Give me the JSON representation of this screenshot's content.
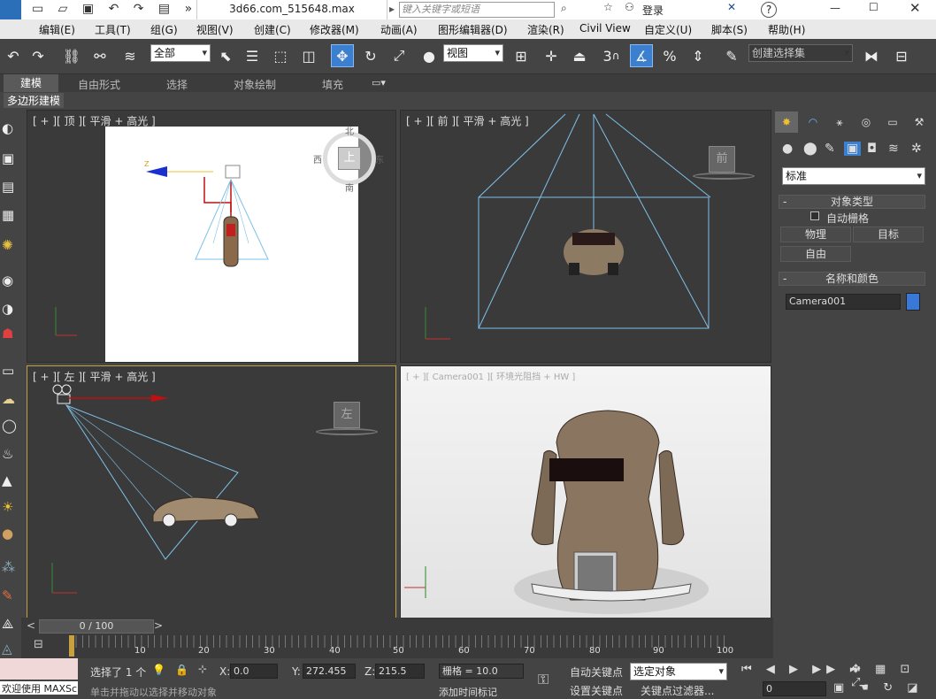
{
  "titlebar": {
    "app_logo": "MAX",
    "file_title": "3d66.com_515648.max",
    "search_placeholder": "键入关键字或短语",
    "login": "登录",
    "help": "?"
  },
  "menus": [
    "编辑(E)",
    "工具(T)",
    "组(G)",
    "视图(V)",
    "创建(C)",
    "修改器(M)",
    "动画(A)",
    "图形编辑器(D)",
    "渲染(R)",
    "Civil View",
    "自定义(U)",
    "脚本(S)",
    "帮助(H)"
  ],
  "toolbar": {
    "selection_filter": "全部",
    "ref_coord": "视图",
    "named_selection": "创建选择集",
    "snap_label": "3"
  },
  "ribbon": {
    "tabs": [
      "建模",
      "自由形式",
      "选择",
      "对象绘制",
      "填充"
    ],
    "active": "建模",
    "sub_label": "多边形建模"
  },
  "viewports": {
    "top": {
      "label": "[ + ][ 顶 ][ 平滑 + 高光 ]",
      "compass": {
        "n": "北",
        "s": "南",
        "e": "东",
        "w": "西",
        "center": "上"
      }
    },
    "front": {
      "label": "[ + ][ 前 ][ 平滑 + 高光 ]",
      "viewcube": "前"
    },
    "left": {
      "label": "[ + ][ 左 ][ 平滑 + 高光 ]",
      "viewcube": "左"
    },
    "camera": {
      "label": "[ + ][ Camera001 ][ 环境光阻挡 + HW ]"
    }
  },
  "cmdpanel": {
    "dropdown": "标准",
    "rollout_object_type": "对象类型",
    "auto_grid": "自动栅格",
    "buttons": [
      "物理",
      "目标",
      "自由"
    ],
    "rollout_name_color": "名称和颜色",
    "object_name": "Camera001",
    "object_color": "#3a78d8"
  },
  "timeline": {
    "frame": "0 / 100",
    "ticks": [
      "0",
      "10",
      "20",
      "30",
      "40",
      "50",
      "60",
      "70",
      "80",
      "90",
      "100"
    ]
  },
  "status": {
    "selected": "选择了 1 个",
    "x_label": "X:",
    "x": "0.0",
    "y_label": "Y:",
    "y": "272.455",
    "z_label": "Z:",
    "z": "215.5",
    "grid": "栅格 = 10.0",
    "autokey": "自动关键点",
    "setkey": "设置关键点",
    "sel_obj": "选定对象",
    "key_filter": "关键点过滤器...",
    "add_time_tag": "添加时间标记",
    "prompt": "单击并拖动以选择并移动对象",
    "welcome": "欢迎使用 MAXSc",
    "frame_field": "0"
  }
}
